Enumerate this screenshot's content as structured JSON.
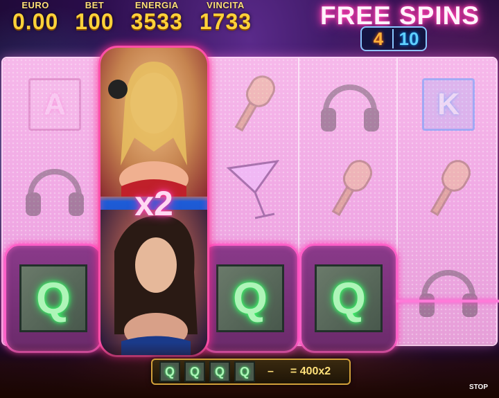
{
  "hud": {
    "euro_label": "EURO",
    "euro_value": "0.00",
    "bet_label": "BET",
    "bet_value": "100",
    "energia_label": "ENERGIA",
    "energia_value": "3533",
    "vincita_label": "VINCITA",
    "vincita_value": "1733"
  },
  "free_spins": {
    "title": "FREE SPINS",
    "current": "4",
    "total": "10"
  },
  "reels": {
    "letter_a": "A",
    "letter_k": "K",
    "q_symbol": "Q",
    "wild_multiplier": "x2"
  },
  "paytable": {
    "dash": "–",
    "win": "= 400x2",
    "q_symbol": "Q"
  },
  "controls": {
    "stop": "STOP"
  },
  "colors": {
    "accent_pink": "#ff4fa8",
    "neon_green": "#38ff6a",
    "gold": "#ffd23a"
  },
  "icons": [
    "headphones-icon",
    "microphone-icon",
    "cocktail-icon"
  ]
}
